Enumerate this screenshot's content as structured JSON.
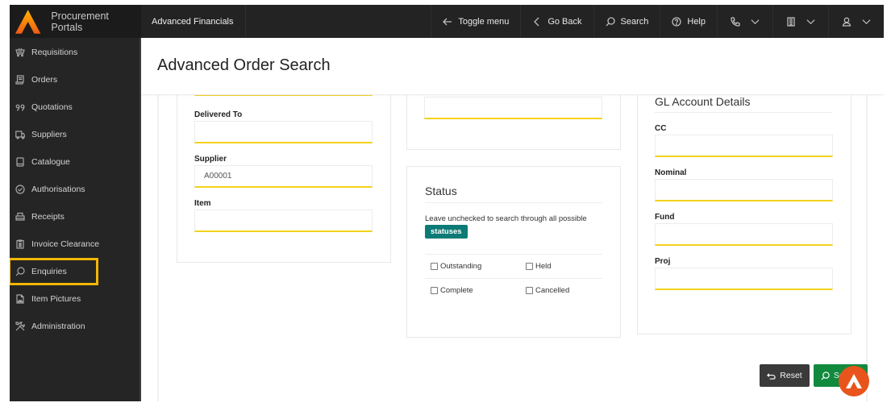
{
  "app": {
    "brand_name": "Procurement Portals",
    "app_name": "Advanced Financials",
    "colors": {
      "accent_yellow": "#f3d21c",
      "highlight": "#f2b705",
      "search_green": "#128a3e",
      "badge_teal": "#0c7b76",
      "fab_orange": "#e8541c"
    }
  },
  "topbar": {
    "items": [
      {
        "label": "Toggle menu",
        "icon": "arrow-left-icon"
      },
      {
        "label": "Go Back",
        "icon": "chevron-left-icon"
      },
      {
        "label": "Search",
        "icon": "search-icon"
      },
      {
        "label": "Help",
        "icon": "help-circle-icon"
      }
    ],
    "dropdowns": [
      {
        "icon": "phone-icon"
      },
      {
        "icon": "building-icon"
      },
      {
        "icon": "user-icon"
      }
    ]
  },
  "sidebar": {
    "items": [
      {
        "label": "Requisitions",
        "icon": "basket-icon"
      },
      {
        "label": "Orders",
        "icon": "receipt-icon"
      },
      {
        "label": "Quotations",
        "icon": "quote-icon"
      },
      {
        "label": "Suppliers",
        "icon": "truck-icon"
      },
      {
        "label": "Catalogue",
        "icon": "book-icon"
      },
      {
        "label": "Authorisations",
        "icon": "check-circle-icon"
      },
      {
        "label": "Receipts",
        "icon": "printer-icon"
      },
      {
        "label": "Invoice Clearance",
        "icon": "clipboard-icon"
      },
      {
        "label": "Enquiries",
        "icon": "search-icon",
        "highlighted": true
      },
      {
        "label": "Item Pictures",
        "icon": "image-file-icon"
      },
      {
        "label": "Administration",
        "icon": "tools-icon"
      }
    ]
  },
  "page": {
    "title": "Advanced Order Search"
  },
  "form": {
    "left": {
      "fields": [
        {
          "label": "",
          "value": "",
          "placeholder": ""
        },
        {
          "label": "Delivered To",
          "value": "",
          "placeholder": ""
        },
        {
          "label": "Supplier",
          "value": "A00001",
          "placeholder": ""
        },
        {
          "label": "Item",
          "value": "",
          "placeholder": ""
        }
      ]
    },
    "middle_top": {
      "fields": [
        {
          "label": "",
          "value": "",
          "placeholder": ""
        }
      ]
    },
    "status": {
      "title": "Status",
      "hint": "Leave unchecked to search through all possible",
      "badge": "statuses",
      "options": [
        {
          "label": "Outstanding",
          "checked": false
        },
        {
          "label": "Held",
          "checked": false
        },
        {
          "label": "Complete",
          "checked": false
        },
        {
          "label": "Cancelled",
          "checked": false
        }
      ]
    },
    "gl_account": {
      "title": "GL Account Details",
      "fields": [
        {
          "label": "CC",
          "value": ""
        },
        {
          "label": "Nominal",
          "value": ""
        },
        {
          "label": "Fund",
          "value": ""
        },
        {
          "label": "Proj",
          "value": ""
        }
      ]
    }
  },
  "actions": {
    "reset_label": "Reset",
    "search_label": "Search"
  }
}
